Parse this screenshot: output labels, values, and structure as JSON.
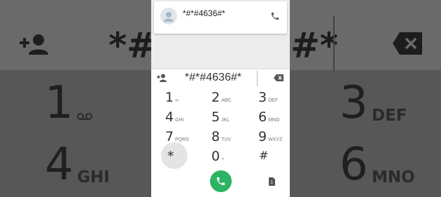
{
  "dialed_number": "*#*#4636#*",
  "suggestion": {
    "number": "*#*#4636#*"
  },
  "colors": {
    "accent_green": "#2bb463",
    "dim_background": "#585858"
  },
  "icons": {
    "add_contact": "add-contact-icon",
    "backspace": "backspace-icon",
    "call": "phone-icon",
    "avatar": "person-icon",
    "sim": "sim-icon"
  },
  "keypad": [
    {
      "digit": "1",
      "letters": "∞"
    },
    {
      "digit": "2",
      "letters": "ABC"
    },
    {
      "digit": "3",
      "letters": "DEF"
    },
    {
      "digit": "4",
      "letters": "GHI"
    },
    {
      "digit": "5",
      "letters": "JKL"
    },
    {
      "digit": "6",
      "letters": "MNO"
    },
    {
      "digit": "7",
      "letters": "PQRS"
    },
    {
      "digit": "8",
      "letters": "TUV"
    },
    {
      "digit": "9",
      "letters": "WXYZ"
    },
    {
      "digit": "*",
      "letters": ""
    },
    {
      "digit": "0",
      "letters": "+"
    },
    {
      "digit": "#",
      "letters": ""
    }
  ],
  "background": {
    "dialed_left": "*#",
    "dialed_right": "#*",
    "keys": [
      {
        "digit": "1",
        "letters": ""
      },
      {
        "digit": "3",
        "letters": "DEF"
      },
      {
        "digit": "4",
        "letters": "GHI"
      },
      {
        "digit": "6",
        "letters": "MNO"
      }
    ]
  }
}
